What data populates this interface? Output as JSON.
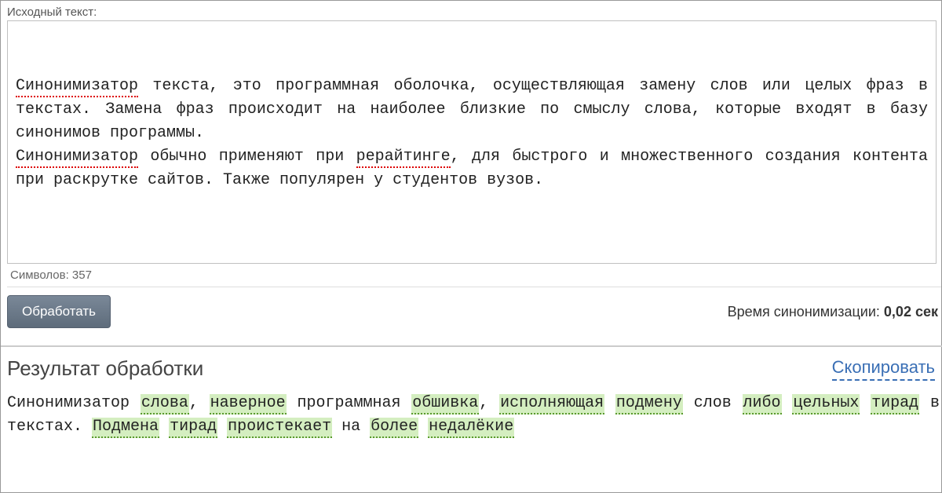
{
  "source": {
    "label": "Исходный текст:",
    "paragraph1": {
      "w1": "Синонимизатор",
      "rest": " текста, это программная оболочка, осуществляющая замену слов или целых фраз в текстах. Замена фраз происходит на наиболее близкие по смыслу слова, которые входят в базу синонимов программы."
    },
    "paragraph2": {
      "w1": "Синонимизатор",
      "mid": " обычно применяют при ",
      "w2": "рерайтинге",
      "rest": ", для быстрого и множественного создания контента при раскрутке сайтов. Также популярен у студентов вузов."
    },
    "counter_label": "Символов: ",
    "counter_value": "357"
  },
  "actions": {
    "process": "Обработать",
    "time_label": "Время синонимизации: ",
    "time_value": "0,02 сек"
  },
  "result": {
    "title": "Результат обработки",
    "copy": "Скопировать",
    "tokens": [
      {
        "t": "Синонимизатор ",
        "s": false
      },
      {
        "t": "слова",
        "s": true
      },
      {
        "t": ", ",
        "s": false
      },
      {
        "t": "наверное",
        "s": true
      },
      {
        "t": " программная ",
        "s": false
      },
      {
        "t": "обшивка",
        "s": true
      },
      {
        "t": ", ",
        "s": false
      },
      {
        "t": "исполняющая",
        "s": true
      },
      {
        "t": " ",
        "s": false
      },
      {
        "t": "подмену",
        "s": true
      },
      {
        "t": " слов ",
        "s": false
      },
      {
        "t": "либо",
        "s": true
      },
      {
        "t": " ",
        "s": false
      },
      {
        "t": "цельных",
        "s": true
      },
      {
        "t": " ",
        "s": false
      },
      {
        "t": "тирад",
        "s": true
      },
      {
        "t": " в текстах. ",
        "s": false
      },
      {
        "t": "Подмена",
        "s": true
      },
      {
        "t": " ",
        "s": false
      },
      {
        "t": "тирад",
        "s": true
      },
      {
        "t": " ",
        "s": false
      },
      {
        "t": "проистекает",
        "s": true
      },
      {
        "t": " на ",
        "s": false
      },
      {
        "t": "более",
        "s": true
      },
      {
        "t": " ",
        "s": false
      },
      {
        "t": "недалёкие",
        "s": true
      }
    ]
  }
}
